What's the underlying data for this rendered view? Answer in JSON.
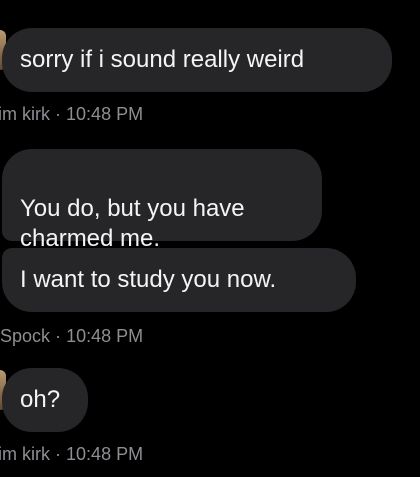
{
  "conversation": {
    "messages": [
      {
        "sender": "kirk",
        "text": "sorry if i sound really weird"
      },
      {
        "sender": "spock",
        "text": "You do, but you have\ncharmed me."
      },
      {
        "sender": "spock",
        "text": "I want to study you now."
      },
      {
        "sender": "kirk",
        "text": "oh?"
      }
    ],
    "metas": [
      {
        "author": "im kirk",
        "separator": "·",
        "time": "10:48 PM"
      },
      {
        "author": "Spock",
        "separator": "·",
        "time": "10:48 PM"
      },
      {
        "author": "im kirk",
        "separator": "·",
        "time": "10:48 PM"
      }
    ]
  },
  "colors": {
    "background": "#000000",
    "bubble": "#262629",
    "meta_text": "#8e8e93"
  }
}
